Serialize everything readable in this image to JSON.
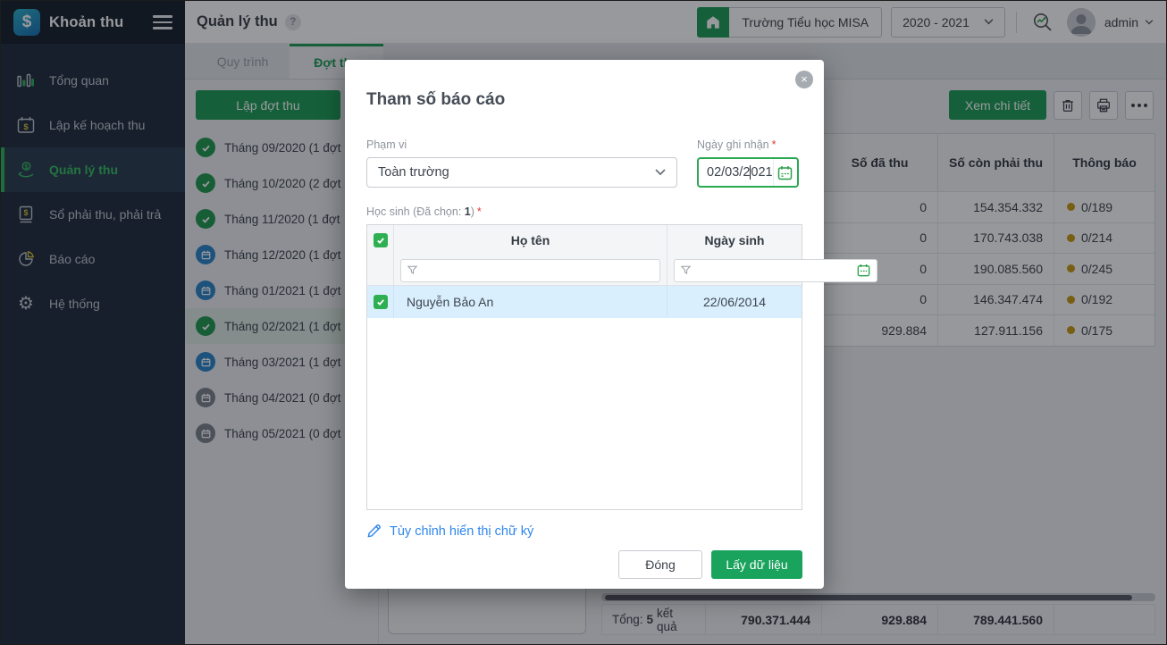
{
  "ui": {
    "logo_glyph": "$",
    "help_glyph": "?",
    "required_mark": "*"
  },
  "colors": {
    "primary_green": "#1e9e57",
    "checkbox_green": "#2eb052",
    "date_border_green": "#2aa952",
    "link_blue": "#2e86ec",
    "selected_row_blue": "#d9effe",
    "selected_month_green": "#dcebe2",
    "status_dot_yellow": "#c79a12",
    "sidebar_bg": "#202e3d"
  },
  "sidebar": {
    "app_title": "Khoản thu",
    "items": [
      {
        "label": "Tổng quan",
        "icon": "bar-chart-icon",
        "active": false
      },
      {
        "label": "Lập kế hoạch thu",
        "icon": "calendar-dollar-icon",
        "active": false
      },
      {
        "label": "Quản lý thu",
        "icon": "hand-coin-icon",
        "active": true
      },
      {
        "label": "Sổ phải thu, phải trả",
        "icon": "book-dollar-icon",
        "active": false
      },
      {
        "label": "Báo cáo",
        "icon": "pie-chart-icon",
        "active": false
      },
      {
        "label": "Hệ thống",
        "icon": "gear-icon",
        "active": false
      }
    ]
  },
  "header": {
    "page_title": "Quản lý thu",
    "school_name": "Trường Tiểu học MISA",
    "school_year": "2020 - 2021",
    "username": "admin"
  },
  "tabs": [
    {
      "label": "Quy trình",
      "active": false
    },
    {
      "label": "Đợt thu",
      "active": true
    }
  ],
  "left_panel": {
    "create_button": "Lập đợt thu",
    "months": [
      {
        "label": "Tháng 09/2020 (1 đợt",
        "status": "done",
        "selected": false
      },
      {
        "label": "Tháng 10/2020 (2 đợt",
        "status": "done",
        "selected": false
      },
      {
        "label": "Tháng 11/2020 (1 đợt",
        "status": "done",
        "selected": false
      },
      {
        "label": "Tháng 12/2020 (1 đợt",
        "status": "scheduled",
        "selected": false
      },
      {
        "label": "Tháng 01/2021 (1 đợt",
        "status": "scheduled",
        "selected": false
      },
      {
        "label": "Tháng 02/2021 (1 đợt",
        "status": "done",
        "selected": true
      },
      {
        "label": "Tháng 03/2021 (1 đợt",
        "status": "scheduled",
        "selected": false
      },
      {
        "label": "Tháng 04/2021 (0 đợt",
        "status": "empty",
        "selected": false
      },
      {
        "label": "Tháng 05/2021 (0 đợt",
        "status": "empty",
        "selected": false
      }
    ]
  },
  "toolbar": {
    "view_details": "Xem chi tiết"
  },
  "revenue_table": {
    "columns": [
      "Số đã thu",
      "Số còn phải thu",
      "Thông báo"
    ],
    "rows": [
      {
        "da_thu": "0",
        "con_phai_thu": "154.354.332",
        "thong_bao": "0/189"
      },
      {
        "da_thu": "0",
        "con_phai_thu": "170.743.038",
        "thong_bao": "0/214"
      },
      {
        "da_thu": "0",
        "con_phai_thu": "190.085.560",
        "thong_bao": "0/245"
      },
      {
        "da_thu": "0",
        "con_phai_thu": "146.347.474",
        "thong_bao": "0/192"
      },
      {
        "da_thu": "929.884",
        "con_phai_thu": "127.911.156",
        "thong_bao": "0/175"
      }
    ],
    "totals": {
      "prefix": "Tổng:",
      "count": "5",
      "suffix": "kết quả",
      "total_phai_thu": "790.371.444",
      "total_da_thu": "929.884",
      "total_con_phai_thu": "789.441.560"
    }
  },
  "modal": {
    "title": "Tham số báo cáo",
    "scope": {
      "label": "Phạm vi",
      "value": "Toàn trường"
    },
    "record_date": {
      "label": "Ngày ghi nhận",
      "before_caret": "02/03/2",
      "after_caret": "021"
    },
    "students": {
      "label_prefix": "Học sinh (Đã chọn:",
      "count": "1",
      "label_suffix": ")",
      "columns": [
        "Họ tên",
        "Ngày sinh"
      ],
      "rows": [
        {
          "name": "Nguyễn Bảo An",
          "dob": "22/06/2014"
        }
      ]
    },
    "signature_link": "Tùy chỉnh hiển thị chữ ký",
    "footer": {
      "close_label": "Đóng",
      "submit_label": "Lấy dữ liệu"
    }
  }
}
